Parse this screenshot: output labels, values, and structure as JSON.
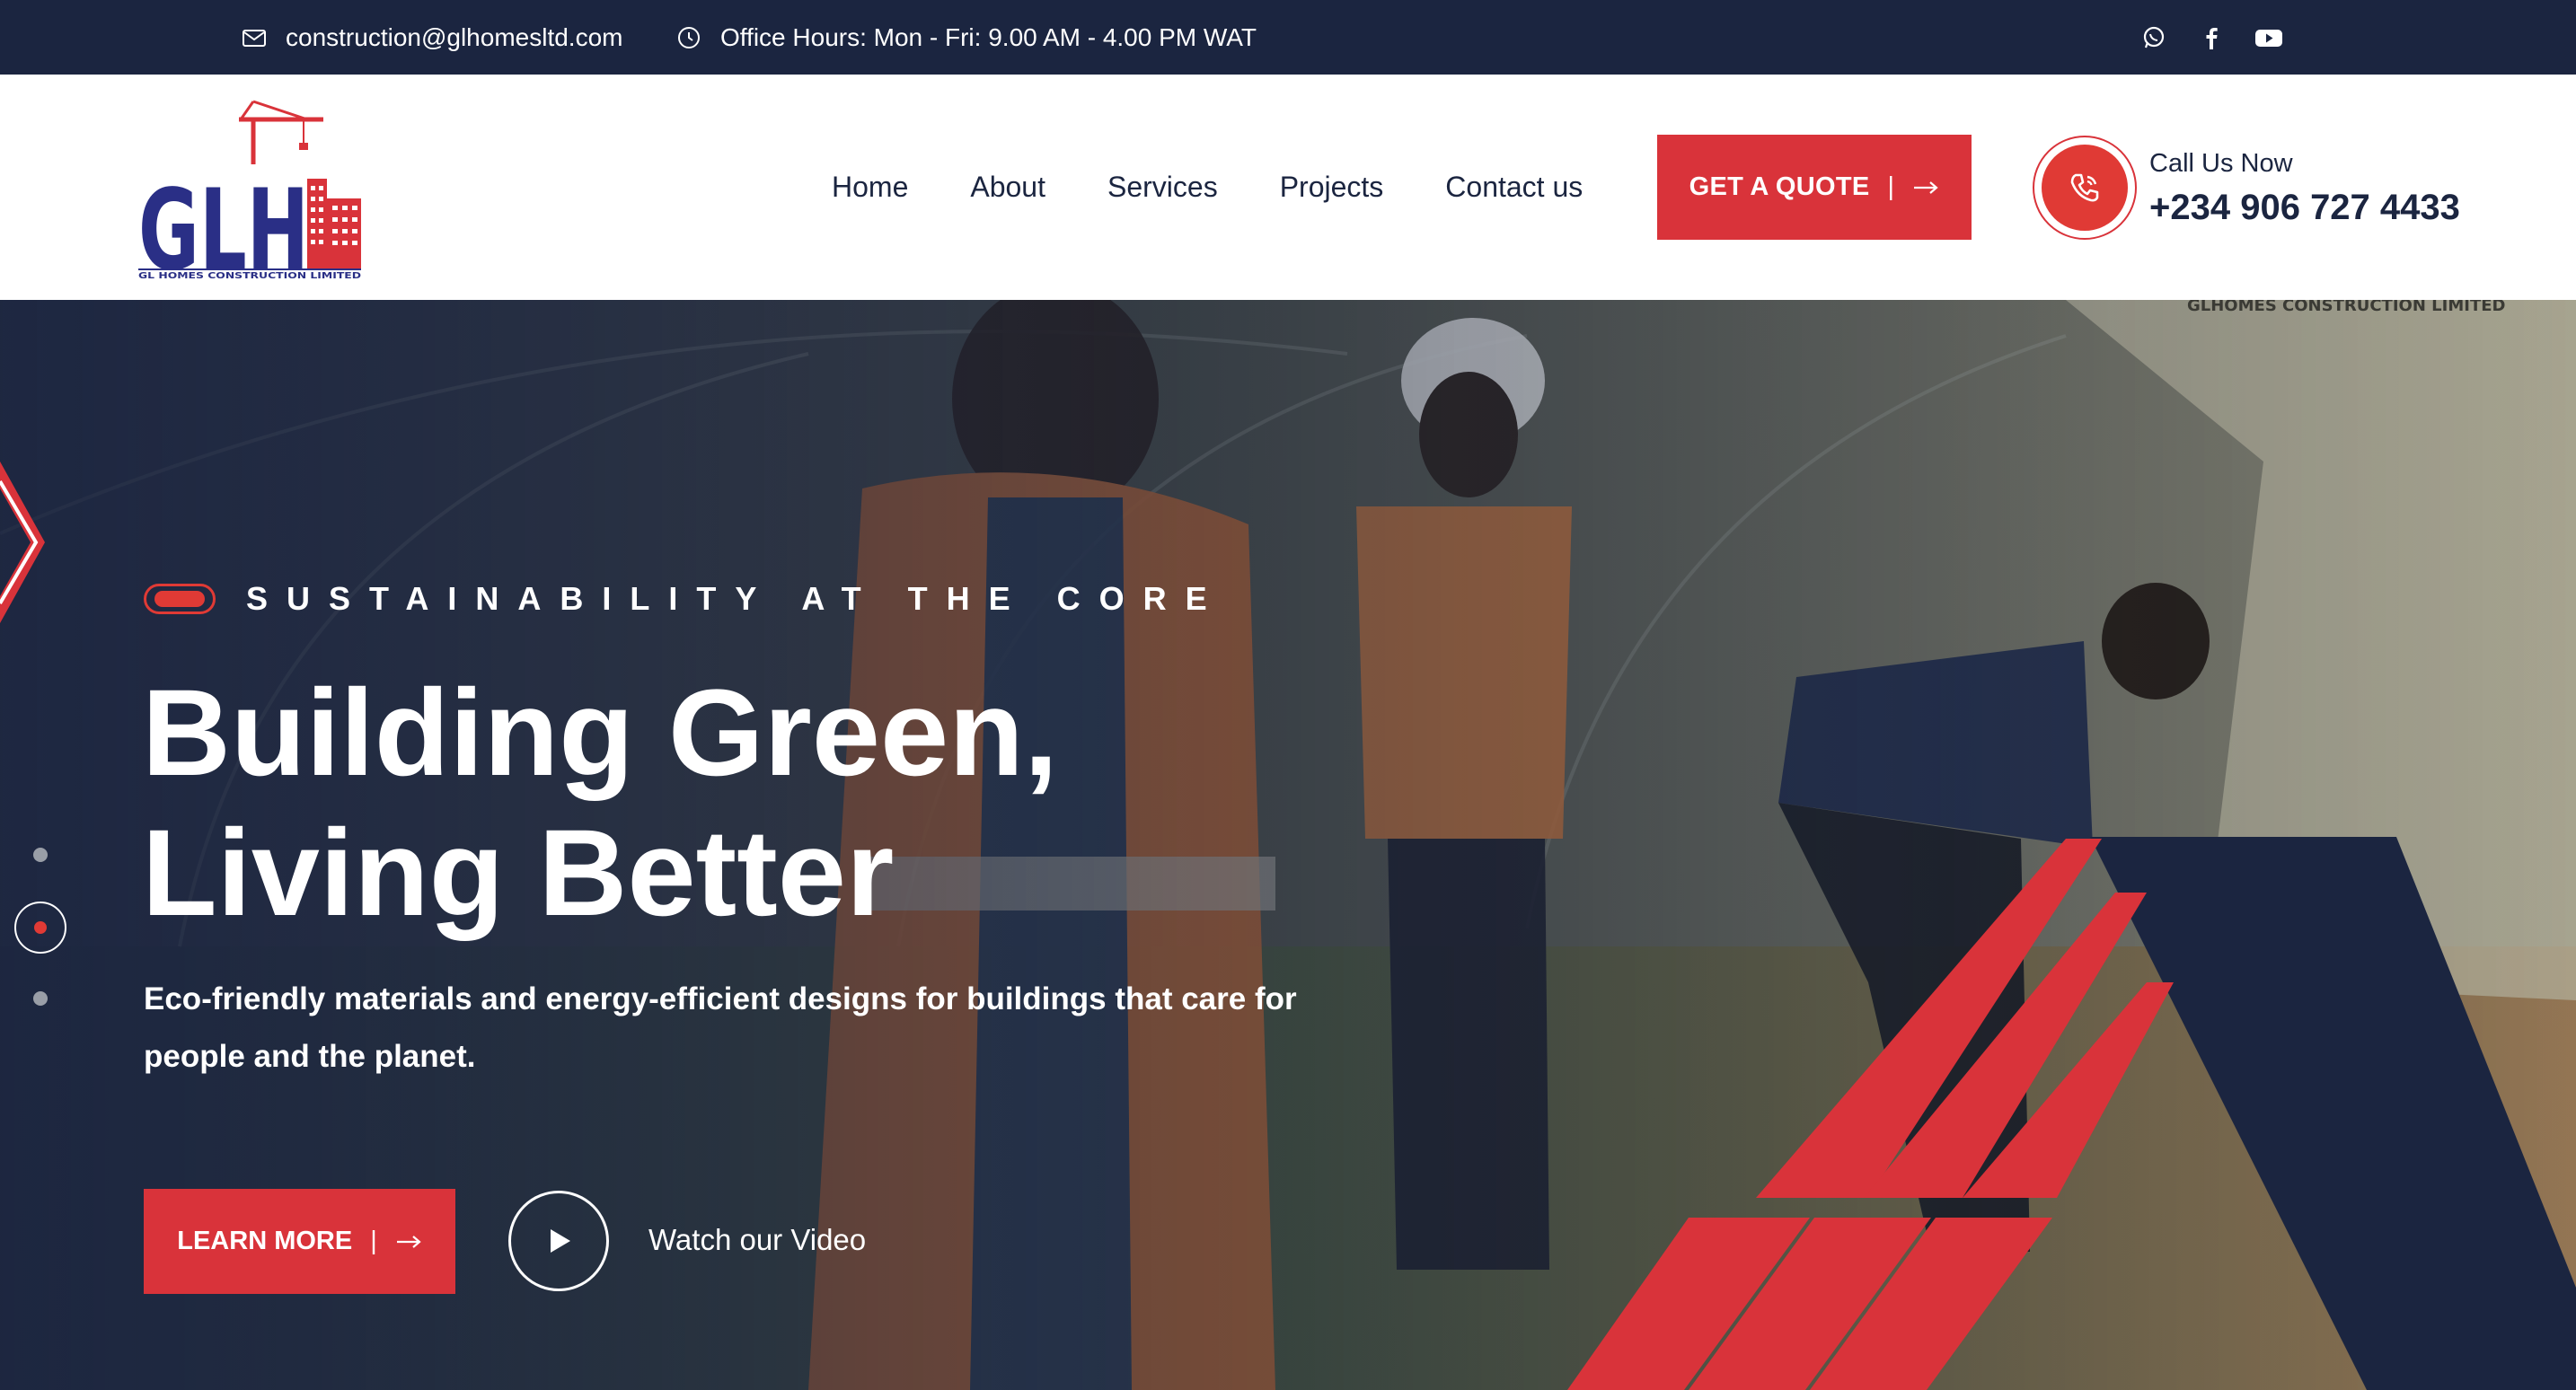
{
  "colors": {
    "navy": "#1b2540",
    "red": "#d9333a",
    "white": "#ffffff"
  },
  "topbar": {
    "email": "construction@glhomesltd.com",
    "hours": "Office Hours: Mon - Fri: 9.00 AM - 4.00 PM WAT",
    "socials": [
      "whatsapp-icon",
      "facebook-icon",
      "youtube-icon"
    ]
  },
  "logo": {
    "letters": "GLH",
    "caption": "GL HOMES CONSTRUCTION LIMITED"
  },
  "nav": {
    "items": [
      {
        "label": "Home"
      },
      {
        "label": "About"
      },
      {
        "label": "Services"
      },
      {
        "label": "Projects"
      },
      {
        "label": "Contact us"
      }
    ],
    "quote_label": "GET A QUOTE",
    "quote_sep": "|"
  },
  "call": {
    "label": "Call Us Now",
    "number": "+234 906 727 4433"
  },
  "hero": {
    "eyebrow": "SUSTAINABILITY AT THE CORE",
    "headline_line1": "Building Green,",
    "headline_line2": "Living Better",
    "subtext": "Eco-friendly materials and energy-efficient designs for buildings that care for people and the planet.",
    "learn_more_label": "LEARN MORE",
    "learn_more_sep": "|",
    "watch_label": "Watch our Video",
    "banner_text": "GLHOMES CONSTRUCTION LIMITED",
    "active_slide": 2,
    "slide_count": 3
  }
}
